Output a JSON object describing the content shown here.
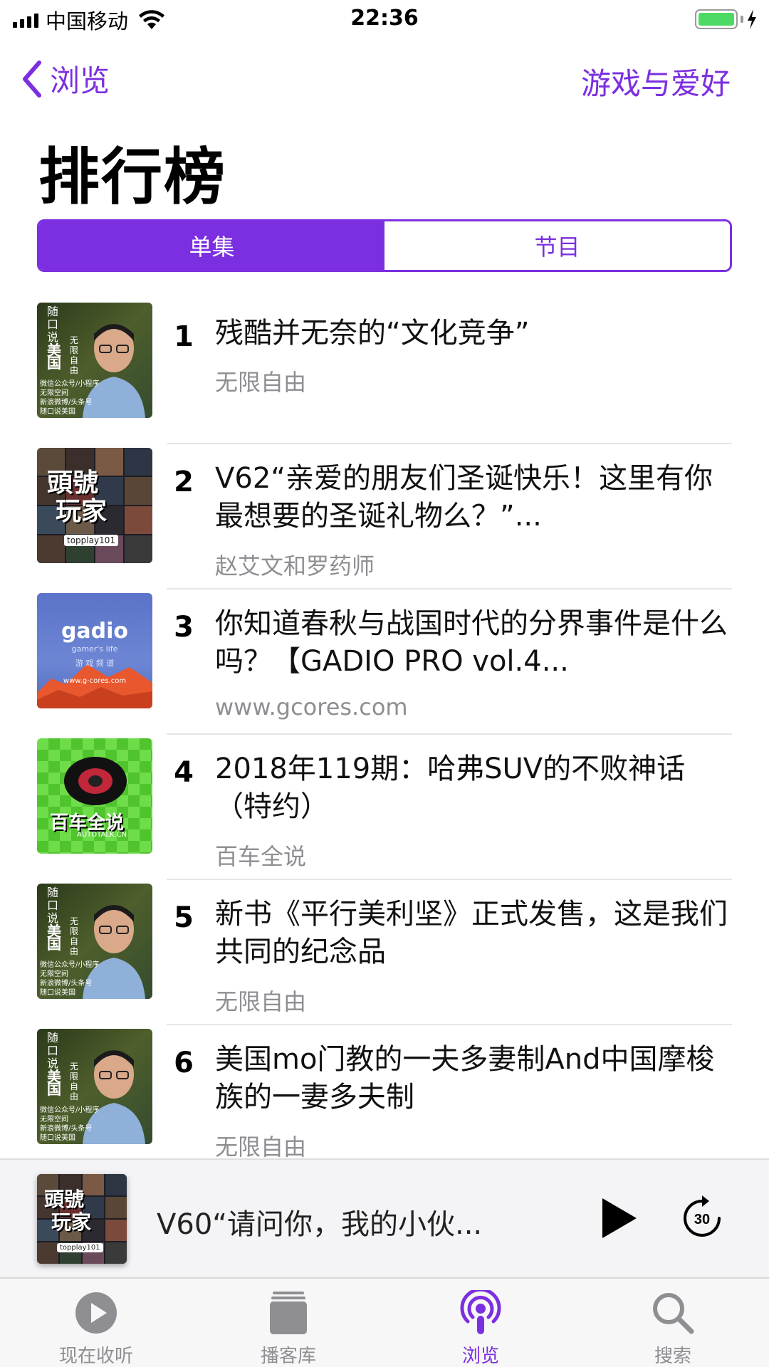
{
  "status_bar": {
    "carrier": "中国移动",
    "time": "22:36"
  },
  "nav": {
    "back_label": "浏览",
    "right_label": "游戏与爱好"
  },
  "page": {
    "title": "排行榜"
  },
  "segmented": {
    "options": [
      "单集",
      "节目"
    ],
    "selected": "单集"
  },
  "episodes": [
    {
      "rank": "1",
      "title": "残酷并无奈的“文化竞争”",
      "author": "无限自由",
      "artwork": "suikou-shuo-meiguo"
    },
    {
      "rank": "2",
      "title": "V62“亲爱的朋友们圣诞快乐！这里有你最想要的圣诞礼物么？”...",
      "author": "赵艾文和罗药师",
      "artwork": "toutou-wanjia"
    },
    {
      "rank": "3",
      "title": "你知道春秋与战国时代的分界事件是什么吗？【GADIO PRO vol.4...",
      "author": "www.gcores.com",
      "artwork": "gadio"
    },
    {
      "rank": "4",
      "title": "2018年119期：哈弗SUV的不败神话（特约）",
      "author": "百车全说",
      "artwork": "baiche-quanshuo"
    },
    {
      "rank": "5",
      "title": "新书《平行美利坚》正式发售，这是我们共同的纪念品",
      "author": "无限自由",
      "artwork": "suikou-shuo-meiguo"
    },
    {
      "rank": "6",
      "title": "美国mo门教的一夫多妻制And中国摩梭族的一妻多夫制",
      "author": "无限自由",
      "artwork": "suikou-shuo-meiguo"
    }
  ],
  "artwork_text": {
    "suikou_lines": [
      "随",
      "口",
      "说",
      "美",
      "国"
    ],
    "suikou_side": [
      "无",
      "限",
      "自",
      "由"
    ],
    "suikou_footer": [
      "微信公众号/小程序",
      "无限空间",
      "新浪微博/头条号",
      "随口说美国"
    ],
    "toutou_logo": [
      "頭號",
      "玩家"
    ],
    "toutou_tag": "topplay101",
    "gadio_logo": "gadio",
    "gadio_sub": "gamer's life",
    "gadio_sub2": "游 戏 频 道",
    "gadio_url": "www.g-cores.com",
    "baiche_logo": "百车全说",
    "baiche_sub": "AUTOTALK.CN"
  },
  "mini_player": {
    "title": "V60“请问你，我的小伙...",
    "play_icon": "play-icon",
    "skip_icon": "skip-forward-30-icon",
    "skip_value": "30"
  },
  "tabs": [
    {
      "label": "现在收听",
      "icon": "play-circle-icon",
      "active": false
    },
    {
      "label": "播客库",
      "icon": "library-icon",
      "active": false
    },
    {
      "label": "浏览",
      "icon": "podcast-icon",
      "active": true
    },
    {
      "label": "搜索",
      "icon": "search-icon",
      "active": false
    }
  ],
  "colors": {
    "accent": "#7b2fe0",
    "secondary_text": "#8e8e93",
    "battery": "#4cd964"
  }
}
